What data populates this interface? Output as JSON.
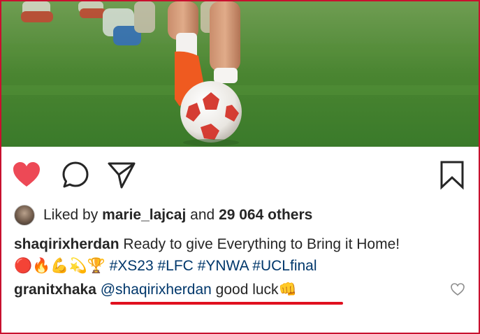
{
  "post": {
    "liked": true,
    "likes": {
      "prefix": "Liked by",
      "user": "marie_lajcaj",
      "conjunction": "and",
      "others": "29 064 others"
    },
    "caption": {
      "username": "shaqirixherdan",
      "text": "Ready to give Everything to Bring it Home!",
      "emojis": "🔴🔥💪💫🏆",
      "hashtags": [
        "#XS23",
        "#LFC",
        "#YNWA",
        "#UCLfinal"
      ]
    },
    "comment": {
      "username": "granitxhaka",
      "mention": "@shaqirixherdan",
      "text": "good luck",
      "emoji": "👊"
    }
  },
  "icons": {
    "like": "heart-filled-icon",
    "comment": "comment-bubble-icon",
    "share": "paper-plane-icon",
    "save": "bookmark-icon",
    "comment_like": "heart-outline-icon"
  },
  "colors": {
    "like_red": "#ed4956",
    "hashtag_blue": "#00376b",
    "annotation_red": "#e0101f"
  }
}
